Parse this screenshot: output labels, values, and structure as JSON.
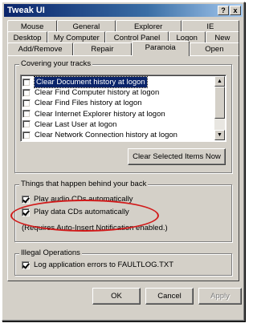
{
  "window": {
    "title": "Tweak UI",
    "help_label": "?",
    "close_label": "x"
  },
  "tabs": {
    "row1": [
      "Mouse",
      "General",
      "Explorer",
      "IE"
    ],
    "row2": [
      "Desktop",
      "My Computer",
      "Control Panel",
      "Logon",
      "New"
    ],
    "row3": [
      "Add/Remove",
      "Repair",
      "Paranoia",
      "Open"
    ],
    "active": "Paranoia"
  },
  "tracks": {
    "title": "Covering your tracks",
    "items": [
      {
        "label": "Clear Document history at logon",
        "checked": false,
        "selected": true
      },
      {
        "label": "Clear Find Computer history at logon",
        "checked": false,
        "selected": false
      },
      {
        "label": "Clear Find Files history at logon",
        "checked": false,
        "selected": false
      },
      {
        "label": "Clear Internet Explorer history at logon",
        "checked": false,
        "selected": false
      },
      {
        "label": "Clear Last User at logon",
        "checked": false,
        "selected": false
      },
      {
        "label": "Clear Network Connection history at logon",
        "checked": false,
        "selected": false
      }
    ],
    "clear_button": "Clear Selected Items Now"
  },
  "behind": {
    "title": "Things that happen behind your back",
    "audio_cd": {
      "label": "Play audio CDs automatically",
      "checked": true
    },
    "data_cd": {
      "label": "Play data CDs automatically",
      "checked": true
    },
    "note": "(Requires Auto-Insert Notification enabled.)"
  },
  "illegal": {
    "title": "Illegal Operations",
    "log_errors": {
      "label": "Log application errors to FAULTLOG.TXT",
      "checked": true
    }
  },
  "footer": {
    "ok": "OK",
    "cancel": "Cancel",
    "apply": "Apply"
  },
  "colors": {
    "face": "#d4d0c8",
    "title_bar": "#0a246a",
    "highlight_oval": "#d11a1a",
    "selection": "#0a246a"
  }
}
